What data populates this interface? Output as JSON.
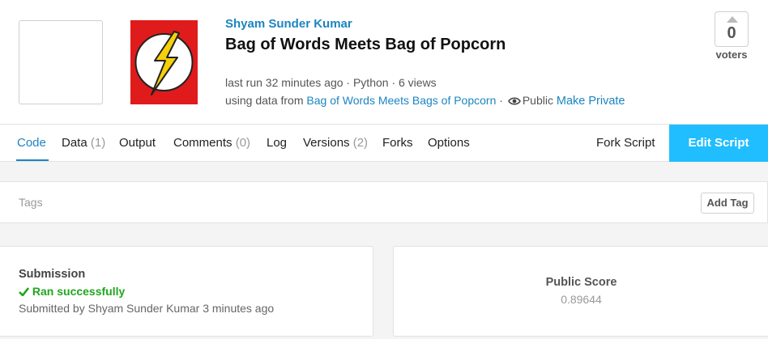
{
  "kernel": {
    "author": "Shyam Sunder Kumar",
    "title": "Bag of Words Meets Bag of Popcorn",
    "meta_line": "last run 32 minutes ago · Python · 6 views",
    "using_data_prefix": "using data from",
    "dataset_link": "Bag of Words Meets Bags of Popcorn",
    "separator": " · ",
    "visibility": "Public",
    "make_private": "Make Private"
  },
  "votes": {
    "count": "0",
    "label": "voters"
  },
  "tabs": [
    {
      "label": "Code",
      "count": ""
    },
    {
      "label": "Data",
      "count": "(1)"
    },
    {
      "label": "Output",
      "count": ""
    },
    {
      "label": "Comments",
      "count": "(0)"
    },
    {
      "label": "Log",
      "count": ""
    },
    {
      "label": "Versions",
      "count": "(2)"
    },
    {
      "label": "Forks",
      "count": ""
    },
    {
      "label": "Options",
      "count": ""
    }
  ],
  "actions": {
    "fork_script": "Fork Script",
    "edit_script": "Edit Script"
  },
  "tags": {
    "label": "Tags",
    "add_tag": "Add Tag"
  },
  "submission": {
    "title": "Submission",
    "status": "Ran successfully",
    "submitted_by": "Submitted by Shyam Sunder Kumar 3 minutes ago"
  },
  "score": {
    "label": "Public Score",
    "value": "0.89644"
  },
  "colors": {
    "link": "#1c85c1",
    "edit_button": "#20beff",
    "success": "#1fa61f",
    "logo_red": "#e01b1b",
    "logo_yellow": "#f5d10a"
  }
}
